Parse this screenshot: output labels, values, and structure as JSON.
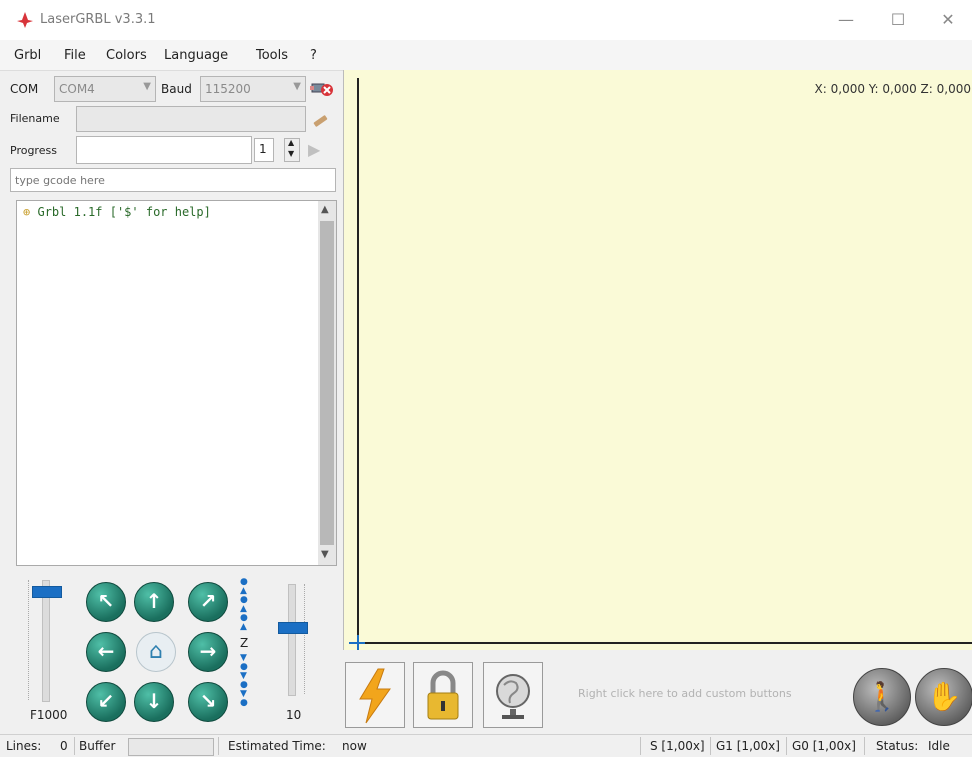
{
  "window": {
    "title": "LaserGRBL v3.3.1",
    "minimize": "—",
    "maximize": "☐",
    "close": "✕"
  },
  "menu": [
    "Grbl",
    "File",
    "Colors",
    "Language",
    "Tools",
    "?"
  ],
  "connection": {
    "com_label": "COM",
    "com_value": "COM4",
    "baud_label": "Baud",
    "baud_value": "115200"
  },
  "file": {
    "filename_label": "Filename",
    "progress_label": "Progress",
    "copies": "1"
  },
  "gcode_input": {
    "placeholder": "type gcode here"
  },
  "console": {
    "lines": [
      "Grbl 1.1f ['$' for help]"
    ]
  },
  "jog": {
    "speed_label": "F1000",
    "step_label": "10",
    "z_label": "Z"
  },
  "canvas": {
    "coords": "X: 0,000 Y: 0,000 Z: 0,000"
  },
  "toolbar": {
    "custom_hint": "Right click here to add custom buttons"
  },
  "status": {
    "lines_label": "Lines:",
    "lines_value": "0",
    "buffer_label": "Buffer",
    "est_label": "Estimated Time:",
    "est_value": "now",
    "s_override": "S [1,00x]",
    "g1_override": "G1 [1,00x]",
    "g0_override": "G0 [1,00x]",
    "status_label": "Status:",
    "status_value": "Idle"
  },
  "colors": {
    "canvas_bg": "#fafad7",
    "jog_green": "#1a6f5e",
    "accent_blue": "#1b6fc4"
  }
}
